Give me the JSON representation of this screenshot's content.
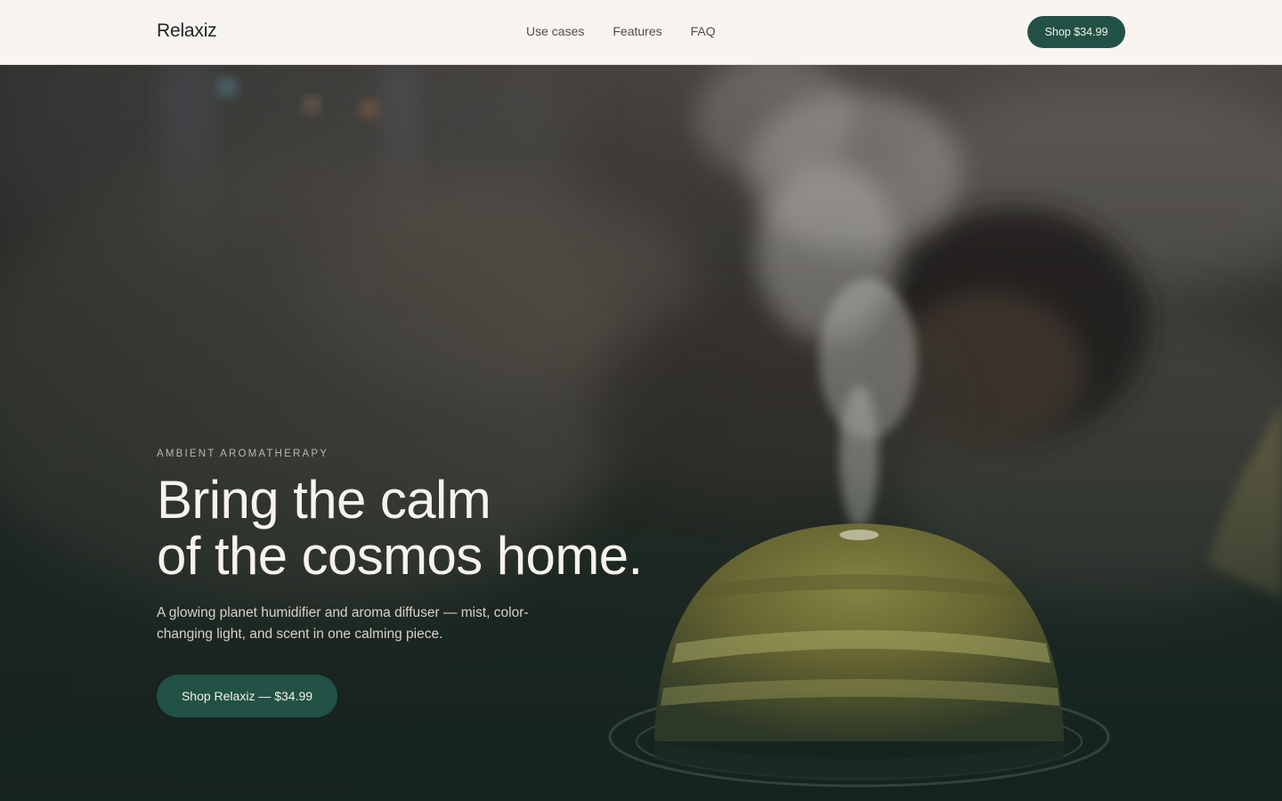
{
  "nav": {
    "brand": "Relaxiz",
    "links": [
      {
        "label": "Use cases"
      },
      {
        "label": "Features"
      },
      {
        "label": "FAQ"
      }
    ],
    "cta_label": "Shop $34.99"
  },
  "hero": {
    "eyebrow": "AMBIENT AROMATHERAPY",
    "headline_line1": "Bring the calm",
    "headline_line2": "of the cosmos home.",
    "subtext": "A glowing planet humidifier and aroma diffuser — mist, color-changing light, and scent in one calming piece.",
    "cta_label": "Shop Relaxiz — $34.99"
  },
  "colors": {
    "accent": "#225245",
    "nav_background": "#f8f5f1",
    "hero_text": "#f7f3ec"
  }
}
